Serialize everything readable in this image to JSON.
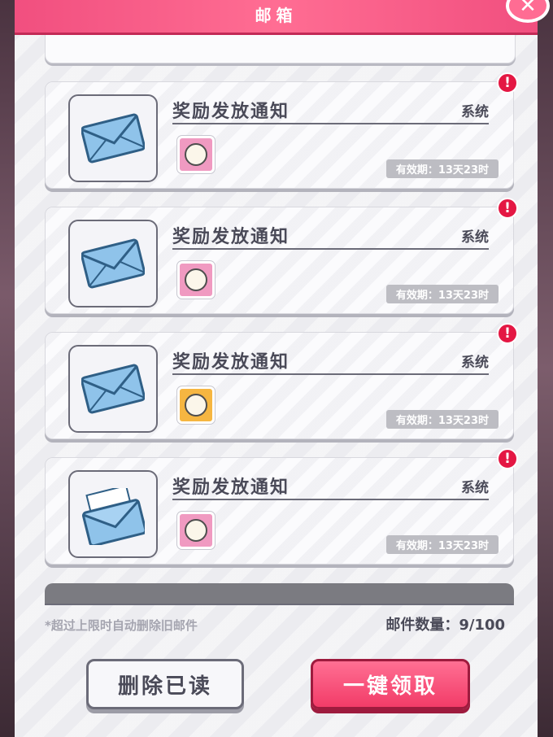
{
  "header": {
    "title": "邮箱",
    "close_icon": "close-icon"
  },
  "mails": [
    {
      "title": "奖励发放通知",
      "sender": "系统",
      "expiry": "有效期：13天23时",
      "status": "unread",
      "envelope": "closed-envelope-icon",
      "reward_icon": "character-card-icon",
      "reward_color": "#f09ac1"
    },
    {
      "title": "奖励发放通知",
      "sender": "系统",
      "expiry": "有效期：13天23时",
      "status": "unread",
      "envelope": "closed-envelope-icon",
      "reward_icon": "character-medal-icon",
      "reward_color": "#f09ac1"
    },
    {
      "title": "奖励发放通知",
      "sender": "系统",
      "expiry": "有效期：13天23时",
      "status": "unread",
      "envelope": "closed-envelope-icon",
      "reward_icon": "character-card-icon",
      "reward_color": "#f6b641"
    },
    {
      "title": "奖励发放通知",
      "sender": "系统",
      "expiry": "有效期：13天23时",
      "status": "unread",
      "envelope": "open-envelope-icon",
      "reward_icon": "character-medal-icon",
      "reward_color": "#f09ac1"
    }
  ],
  "footer": {
    "note": "*超过上限时自动删除旧邮件",
    "count": "邮件数量：9/100",
    "delete_read_label": "删除已读",
    "claim_all_label": "一键领取"
  },
  "colors": {
    "accent": "#f14f7f",
    "alert": "#e41743",
    "text": "#4a4a58"
  }
}
